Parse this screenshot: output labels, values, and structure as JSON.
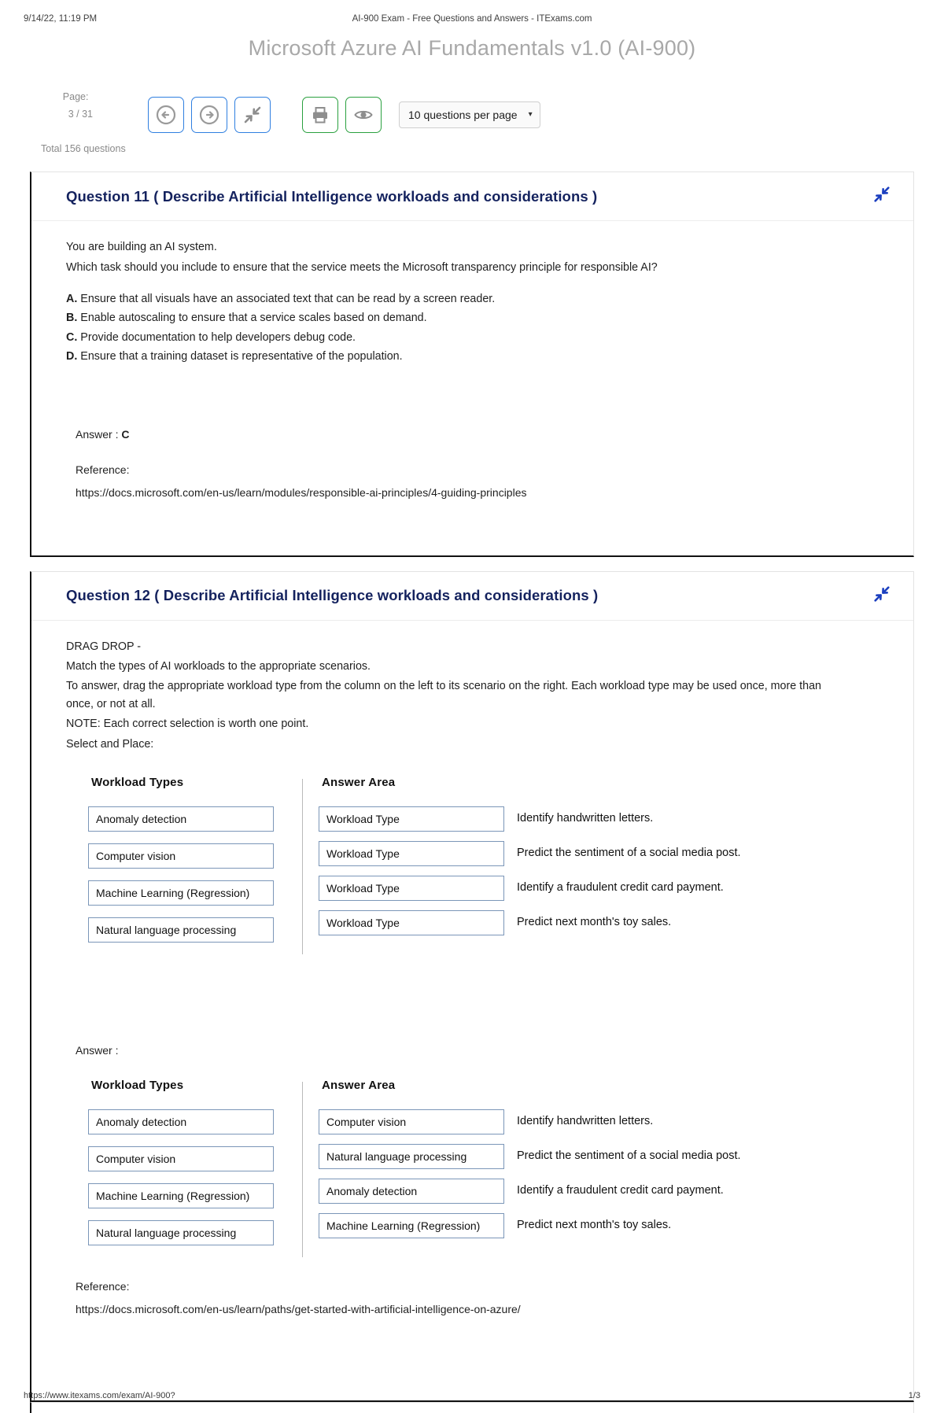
{
  "print_header": {
    "date": "9/14/22, 11:19 PM",
    "title": "AI-900 Exam - Free Questions and Answers - ITExams.com"
  },
  "exam_title": "Microsoft Azure AI Fundamentals v1.0 (AI-900)",
  "toolbar": {
    "page_label": "Page:",
    "page_value": "3 / 31",
    "total_label": "Total 156 questions",
    "buttons": [
      {
        "name": "previous-page-button",
        "icon": "arrow-left-circle-icon",
        "color": "#2f7fe0"
      },
      {
        "name": "next-page-button",
        "icon": "arrow-right-circle-icon",
        "color": "#2f7fe0"
      },
      {
        "name": "collapse-all-button",
        "icon": "collapse-arrows-icon",
        "color": "#2f7fe0"
      },
      {
        "name": "print-button",
        "icon": "printer-icon",
        "color": "#2aa03f"
      },
      {
        "name": "preview-button",
        "icon": "eye-icon",
        "color": "#2aa03f"
      }
    ],
    "per_page_select": {
      "value": "10 questions per page",
      "caret": "▾"
    }
  },
  "questions": [
    {
      "id": "q11",
      "title": "Question 11 ( Describe Artificial Intelligence workloads and considerations )",
      "intro_lines": [
        "You are building an AI system.",
        "Which task should you include to ensure that the service meets the Microsoft transparency principle for responsible AI?"
      ],
      "choices": [
        {
          "letter": "A.",
          "text": "Ensure that all visuals have an associated text that can be read by a screen reader."
        },
        {
          "letter": "B.",
          "text": "Enable autoscaling to ensure that a service scales based on demand."
        },
        {
          "letter": "C.",
          "text": "Provide documentation to help developers debug code."
        },
        {
          "letter": "D.",
          "text": "Ensure that a training dataset is representative of the population."
        }
      ],
      "answer_label": "Answer :",
      "answer_value": "C",
      "reference_label": "Reference:",
      "reference_url": "https://docs.microsoft.com/en-us/learn/modules/responsible-ai-principles/4-guiding-principles"
    },
    {
      "id": "q12",
      "title": "Question 12 ( Describe Artificial Intelligence workloads and considerations )",
      "intro_lines": [
        "DRAG DROP -",
        "Match the types of AI workloads to the appropriate scenarios.",
        "To answer, drag the appropriate workload type from the column on the left to its scenario on the right. Each workload type may be used once, more than once, or not at all.",
        "NOTE: Each correct selection is worth one point.",
        "Select and Place:"
      ],
      "question_diagram": {
        "left_header": "Workload Types",
        "right_header": "Answer Area",
        "workload_types": [
          "Anomaly detection",
          "Computer vision",
          "Machine Learning (Regression)",
          "Natural language processing"
        ],
        "rows": [
          {
            "slot": "Workload Type",
            "scenario": "Identify handwritten letters."
          },
          {
            "slot": "Workload Type",
            "scenario": "Predict the sentiment of a social media post."
          },
          {
            "slot": "Workload Type",
            "scenario": "Identify a fraudulent credit card payment."
          },
          {
            "slot": "Workload Type",
            "scenario": "Predict next month's toy sales."
          }
        ]
      },
      "answer_label": "Answer :",
      "answer_diagram": {
        "left_header": "Workload Types",
        "right_header": "Answer Area",
        "workload_types": [
          "Anomaly detection",
          "Computer vision",
          "Machine Learning (Regression)",
          "Natural language processing"
        ],
        "rows": [
          {
            "slot": "Computer vision",
            "scenario": "Identify handwritten letters."
          },
          {
            "slot": "Natural language processing",
            "scenario": "Predict the sentiment of a social media post."
          },
          {
            "slot": "Anomaly detection",
            "scenario": "Identify a fraudulent credit card payment."
          },
          {
            "slot": "Machine Learning (Regression)",
            "scenario": "Predict next month's toy sales."
          }
        ]
      },
      "reference_label": "Reference:",
      "reference_url": "https://docs.microsoft.com/en-us/learn/paths/get-started-with-artificial-intelligence-on-azure/"
    }
  ],
  "footer": {
    "url": "https://www.itexams.com/exam/AI-900?",
    "page": "1/3"
  }
}
